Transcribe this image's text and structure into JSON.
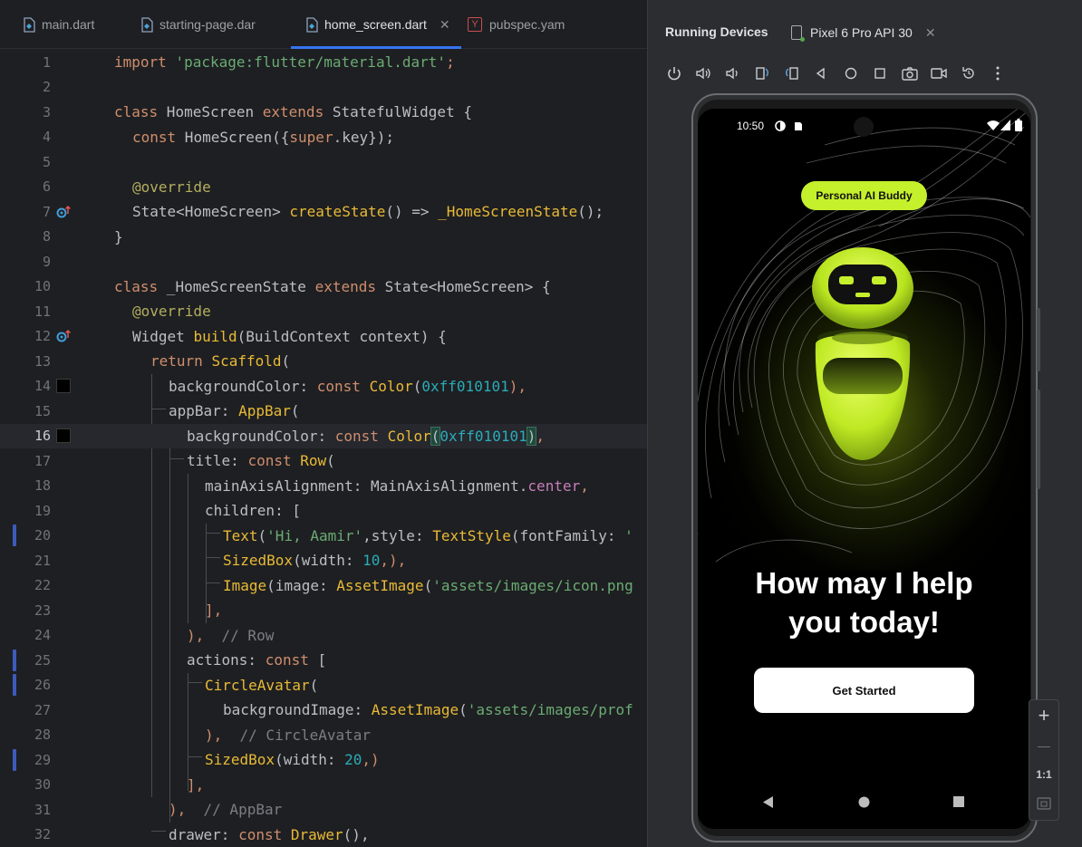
{
  "editor": {
    "tabs": [
      {
        "label": "main.dart",
        "icon": "dart-file-icon"
      },
      {
        "label": "starting-page.dar",
        "icon": "dart-file-icon"
      },
      {
        "label": "home_screen.dart",
        "icon": "dart-file-icon",
        "active": true
      },
      {
        "label": "pubspec.yam",
        "icon": "yaml-file-icon"
      }
    ],
    "close_glyph": "✕",
    "yaml_glyph": "Y",
    "line_numbers": [
      "1",
      "2",
      "3",
      "4",
      "5",
      "6",
      "7",
      "8",
      "9",
      "10",
      "11",
      "12",
      "13",
      "14",
      "15",
      "16",
      "17",
      "18",
      "19",
      "20",
      "21",
      "22",
      "23",
      "24",
      "25",
      "26",
      "27",
      "28",
      "29",
      "30",
      "31",
      "32"
    ],
    "current_line": 16,
    "code": {
      "l1": [
        "import",
        " ",
        "'package:flutter/material.dart'",
        ";"
      ],
      "l3": [
        "class",
        " HomeScreen ",
        "extends",
        " StatefulWidget {"
      ],
      "l4": [
        "const",
        " HomeScreen({",
        "super",
        ".key});"
      ],
      "l6": "@override",
      "l7": [
        "State<HomeScreen> ",
        "createState",
        "() => ",
        "_HomeScreenState",
        "();"
      ],
      "l8": "}",
      "l10": [
        "class",
        " _HomeScreenState ",
        "extends",
        " State<HomeScreen> {"
      ],
      "l11": "@override",
      "l12": [
        "Widget ",
        "build",
        "(BuildContext context) {"
      ],
      "l13": [
        "return",
        " ",
        "Scaffold",
        "("
      ],
      "l14": [
        "backgroundColor: ",
        "const",
        " ",
        "Color",
        "(",
        "0xff010101",
        "),"
      ],
      "l15": [
        "appBar: ",
        "AppBar",
        "("
      ],
      "l16": [
        "backgroundColor: ",
        "const",
        " ",
        "Color",
        "(",
        "0xff010101",
        ")",
        ","
      ],
      "l17": [
        "title: ",
        "const",
        " ",
        "Row",
        "("
      ],
      "l18": [
        "mainAxisAlignment: MainAxisAlignment.",
        "center",
        ","
      ],
      "l19": "children: [",
      "l20": [
        "Text",
        "(",
        "'Hi, Aamir'",
        ",style: ",
        "TextStyle",
        "(fontFamily: ",
        "'"
      ],
      "l21": [
        "SizedBox",
        "(width: ",
        "10",
        ",),"
      ],
      "l22": [
        "Image",
        "(image: ",
        "AssetImage",
        "(",
        "'assets/images/icon.png"
      ],
      "l23": "],",
      "l24": [
        "),",
        "  // Row"
      ],
      "l25": [
        "actions: ",
        "const",
        " ["
      ],
      "l26": [
        "CircleAvatar",
        "("
      ],
      "l27": [
        "backgroundImage: ",
        "AssetImage",
        "(",
        "'assets/images/prof"
      ],
      "l28": [
        "),",
        "  // CircleAvatar"
      ],
      "l29": [
        "SizedBox",
        "(width: ",
        "20",
        ",)"
      ],
      "l30": "],",
      "l31": [
        "),",
        "  // AppBar"
      ],
      "l32": [
        "drawer: ",
        "const",
        " ",
        "Drawer",
        "(),"
      ]
    }
  },
  "devices": {
    "title": "Running Devices",
    "device_tab": "Pixel 6 Pro API 30",
    "toolbar_icons": [
      "power-icon",
      "volume-up-icon",
      "volume-down-icon",
      "rotate-left-icon",
      "rotate-right-icon",
      "back-icon",
      "home-icon",
      "overview-icon",
      "screenshot-icon",
      "screen-record-icon",
      "reset-icon",
      "more-icon"
    ],
    "zoom": {
      "plus": "+",
      "minus": "—",
      "actual": "1:1"
    }
  },
  "app": {
    "status_time": "10:50",
    "chip_label": "Personal AI Buddy",
    "headline_line1": "How may I help",
    "headline_line2": "you today!",
    "cta_label": "Get Started",
    "accent": "#c5f02c"
  }
}
